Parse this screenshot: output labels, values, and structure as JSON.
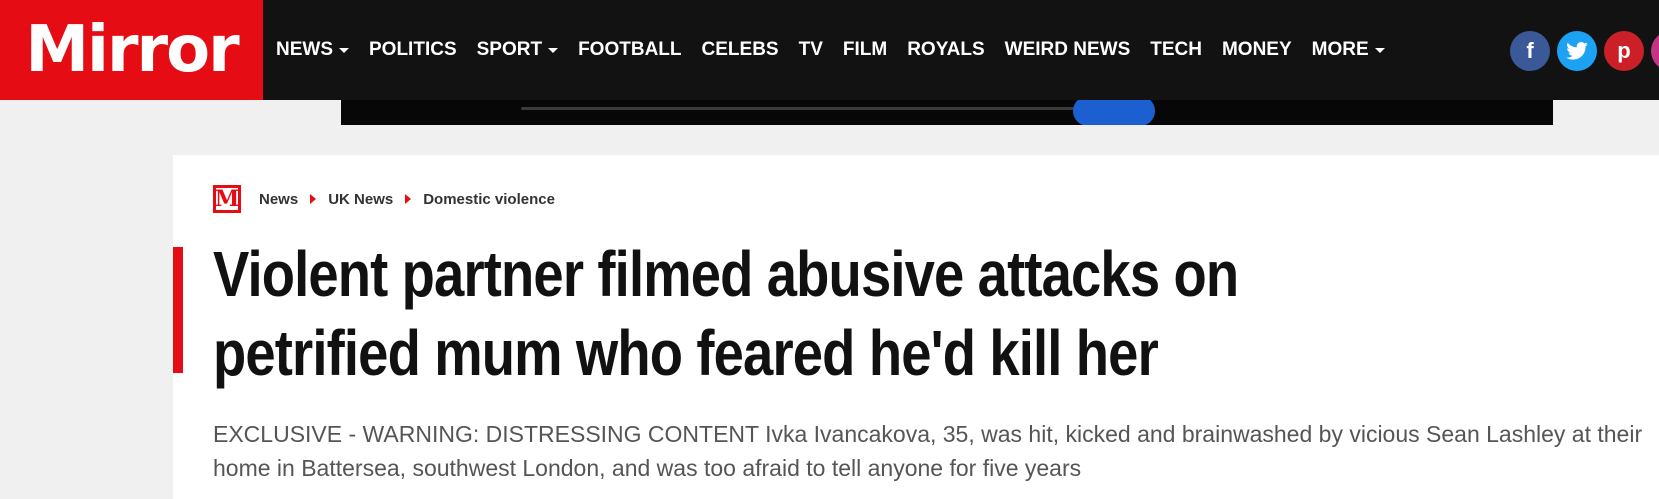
{
  "header": {
    "logo_text": "Mirror",
    "nav": [
      {
        "label": "NEWS",
        "dropdown": true
      },
      {
        "label": "POLITICS",
        "dropdown": false
      },
      {
        "label": "SPORT",
        "dropdown": true
      },
      {
        "label": "FOOTBALL",
        "dropdown": false
      },
      {
        "label": "CELEBS",
        "dropdown": false
      },
      {
        "label": "TV",
        "dropdown": false
      },
      {
        "label": "FILM",
        "dropdown": false
      },
      {
        "label": "ROYALS",
        "dropdown": false
      },
      {
        "label": "WEIRD NEWS",
        "dropdown": false
      },
      {
        "label": "TECH",
        "dropdown": false
      },
      {
        "label": "MONEY",
        "dropdown": false
      },
      {
        "label": "MORE",
        "dropdown": true
      }
    ],
    "social": [
      {
        "icon": "facebook-icon",
        "glyph": "f",
        "color": "#3b5998"
      },
      {
        "icon": "twitter-icon",
        "glyph": "t",
        "color": "#1da1f2"
      },
      {
        "icon": "pinterest-icon",
        "glyph": "p",
        "color": "#cb2027"
      },
      {
        "icon": "instagram-icon",
        "glyph": "",
        "color": "#c13584"
      }
    ]
  },
  "breadcrumb": {
    "logo_letter": "M",
    "items": [
      "News",
      "UK News",
      "Domestic violence"
    ]
  },
  "article": {
    "headline": "Violent partner filmed abusive attacks on petrified mum who feared he'd kill her",
    "standfirst": "EXCLUSIVE - WARNING: DISTRESSING CONTENT Ivka Ivancakova, 35, was hit, kicked and brainwashed by vicious Sean Lashley at their home in Battersea, southwest London, and was too afraid to tell anyone for five years"
  },
  "colors": {
    "brand_red": "#e50c14",
    "nav_background": "#121212",
    "page_background": "#f0f0f0"
  }
}
